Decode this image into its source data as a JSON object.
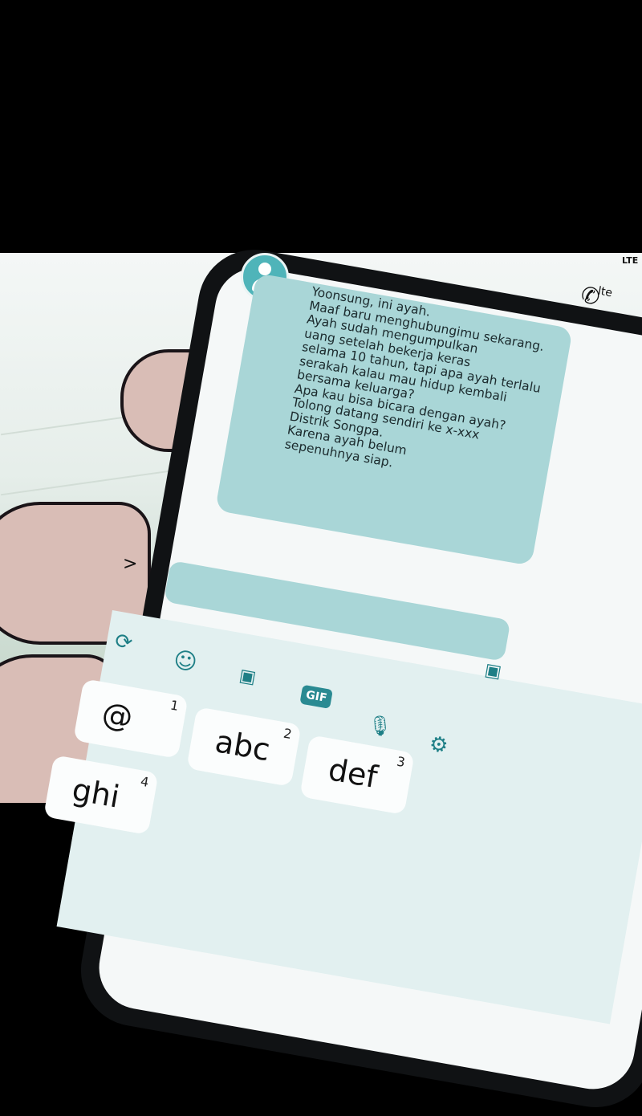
{
  "status": {
    "network_label": "LTE",
    "call_label": "lte"
  },
  "message": {
    "lines": [
      "Yoonsung, ini ayah.",
      "Maaf baru menghubungimu sekarang.",
      "Ayah sudah mengumpulkan",
      "uang setelah bekerja keras",
      "selama 10 tahun, tapi apa ayah terlalu",
      "serakah kalau mau hidup kembali",
      "bersama keluarga?",
      "Apa kau bisa bicara dengan ayah?",
      "Tolong datang sendiri ke x-xxx",
      "Distrik Songpa.",
      "Karena ayah belum",
      "sepenuhnya siap."
    ]
  },
  "input": {
    "value": ""
  },
  "keyboard": {
    "toolbar": {
      "gif_label": "GIF"
    },
    "keys": [
      {
        "label": "@",
        "num": "1"
      },
      {
        "label": "abc",
        "num": "2"
      },
      {
        "label": "def",
        "num": "3"
      },
      {
        "label": "ghi",
        "num": "4"
      }
    ]
  },
  "colors": {
    "bubble": "#a9d6d7",
    "accent": "#4fb4b9",
    "keyboard_bg": "#e2f0f0"
  }
}
